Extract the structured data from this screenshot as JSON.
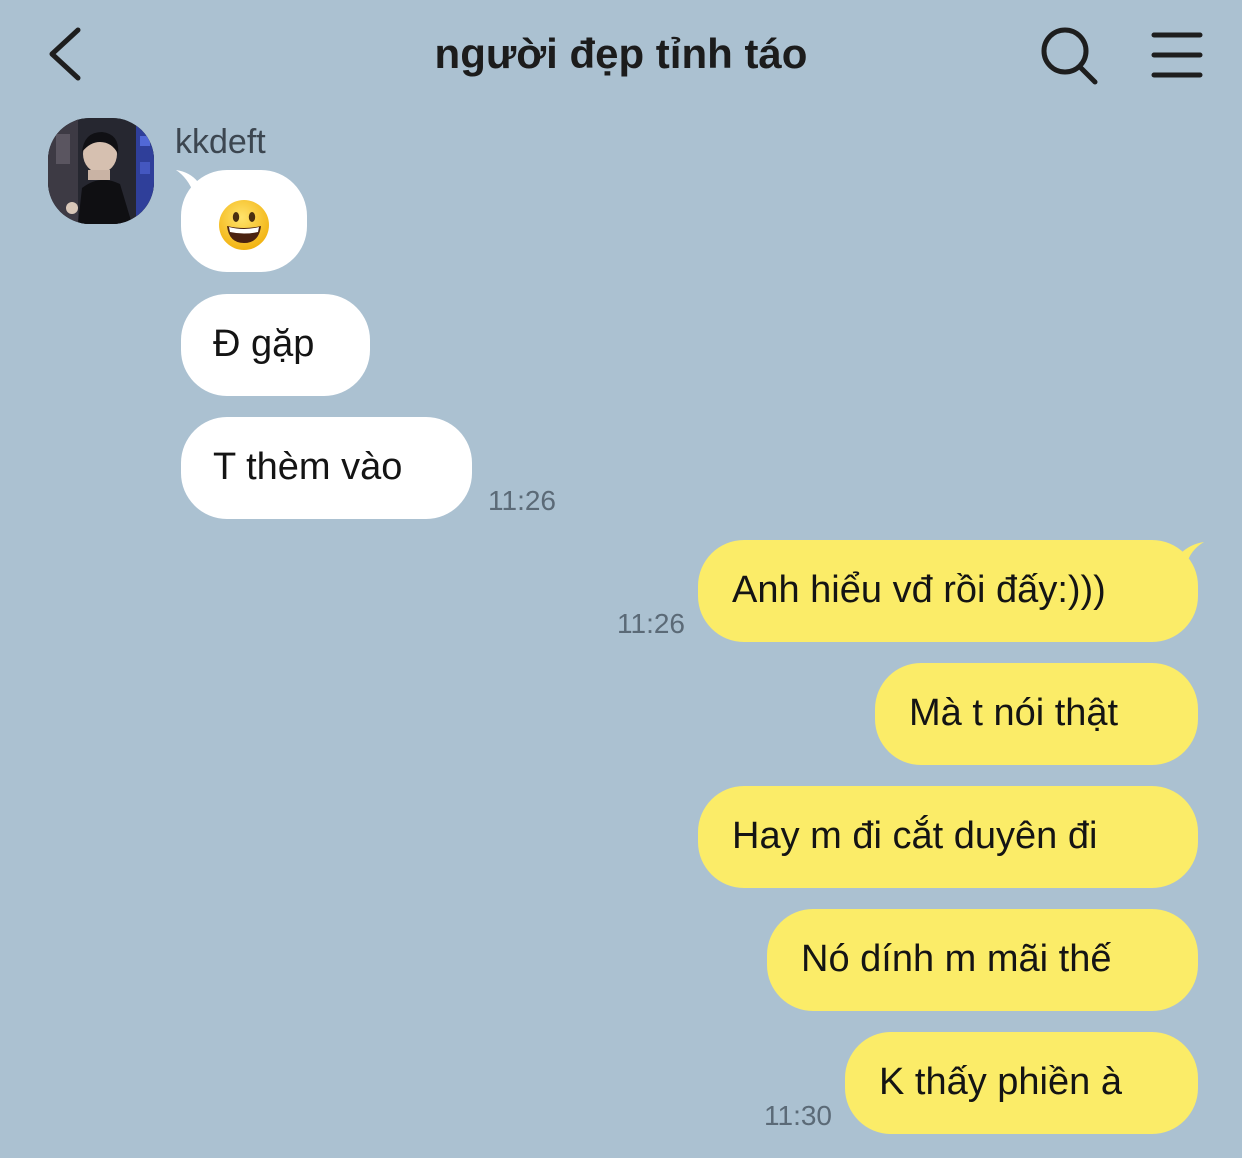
{
  "header": {
    "title": "người đẹp tỉnh táo"
  },
  "icons": {
    "back": "chevron-left-icon",
    "search": "search-icon",
    "menu": "hamburger-menu-icon",
    "emoji": "grinning-face-emoji"
  },
  "colors": {
    "background": "#abc1d1",
    "incoming_bubble": "#ffffff",
    "outgoing_bubble": "#fbec68",
    "timestamp": "#5b6a77"
  },
  "conversation": {
    "sender_name": "kkdeft",
    "incoming": [
      {
        "text": ""
      },
      {
        "text": "Đ gặp"
      },
      {
        "text": "T thèm vào"
      }
    ],
    "incoming_time": "11:26",
    "outgoing": [
      {
        "text": "Anh hiểu vđ rồi đấy:)))",
        "time": "11:26"
      },
      {
        "text": "Mà t nói thật"
      },
      {
        "text": "Hay m đi cắt duyên đi"
      },
      {
        "text": "Nó dính m mãi thế"
      },
      {
        "text": "K thấy phiền à",
        "time": "11:30"
      }
    ]
  }
}
